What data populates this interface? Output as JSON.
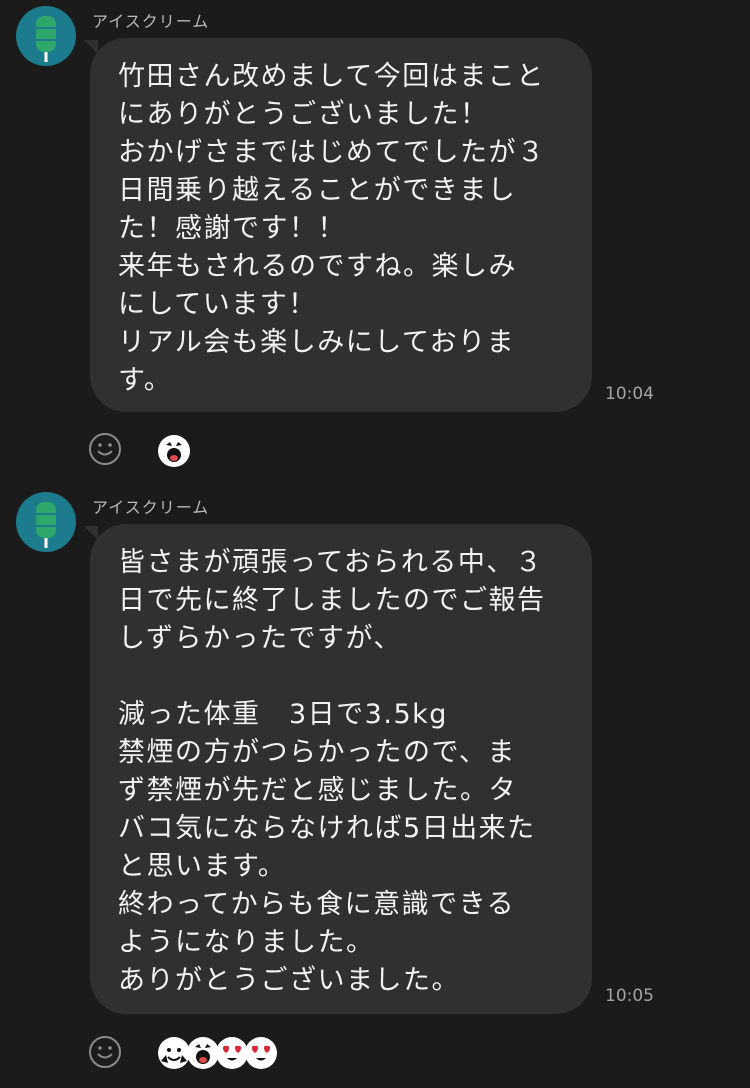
{
  "messages": [
    {
      "sender": "アイスクリーム",
      "avatar_icon": "popsicle-icon",
      "text": "竹田さん改めまして今回はまこと\nにありがとうございました！\nおかげさまではじめてでしたが３\n日間乗り越えることができまし\nた！感謝です！！\n来年もされるのですね。楽しみ\nにしています！\nリアル会も楽しみにしておりま\nす。",
      "time": "10:04",
      "reaction_stickers": [
        "laughing-face-sticker"
      ]
    },
    {
      "sender": "アイスクリーム",
      "avatar_icon": "popsicle-icon",
      "text": "皆さまが頑張っておられる中、３\n日で先に終了しましたのでご報告\nしずらかったですが、\n\n減った体重　3日で3.5kg\n禁煙の方がつらかったので、ま\nず禁煙が先だと感じました。タ\nバコ気にならなければ5日出来た\nと思います。\n終わってからも食に意識できる\nようになりました。\nありがとうございました。",
      "time": "10:05",
      "reaction_stickers": [
        "clapping-face-sticker",
        "laughing-face-sticker",
        "heart-eyes-face-sticker",
        "heart-eyes-face-sticker"
      ]
    }
  ],
  "colors": {
    "background": "#1b1b1b",
    "bubble": "#303030",
    "avatar": "#1c7b8c",
    "popsicle": "#2ea86a"
  }
}
